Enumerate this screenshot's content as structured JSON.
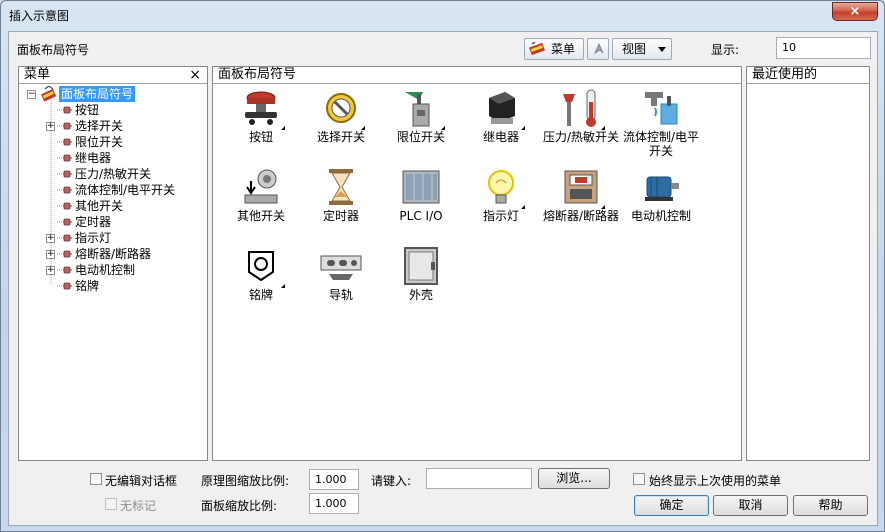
{
  "window": {
    "title": "插入示意图",
    "close_glyph": "×"
  },
  "header": {
    "section_label": "面板布局符号",
    "menu_button": "菜单",
    "view_button": "视图",
    "display_label": "显示:",
    "display_value": "10"
  },
  "menu_panel": {
    "title": "菜单",
    "close_glyph": "×",
    "root": "面板布局符号",
    "items": [
      {
        "label": "按钮",
        "expandable": false
      },
      {
        "label": "选择开关",
        "expandable": true
      },
      {
        "label": "限位开关",
        "expandable": false
      },
      {
        "label": "继电器",
        "expandable": false
      },
      {
        "label": "压力/热敏开关",
        "expandable": false
      },
      {
        "label": "流体控制/电平开关",
        "expandable": false
      },
      {
        "label": "其他开关",
        "expandable": false
      },
      {
        "label": "定时器",
        "expandable": false
      },
      {
        "label": "指示灯",
        "expandable": true
      },
      {
        "label": "熔断器/断路器",
        "expandable": true
      },
      {
        "label": "电动机控制",
        "expandable": true
      },
      {
        "label": "铭牌",
        "expandable": false
      }
    ]
  },
  "symbols_panel": {
    "title": "面板布局符号",
    "symbols": [
      {
        "label": "按钮",
        "icon": "push-button-icon"
      },
      {
        "label": "选择开关",
        "icon": "selector-switch-icon"
      },
      {
        "label": "限位开关",
        "icon": "limit-switch-icon"
      },
      {
        "label": "继电器",
        "icon": "relay-icon"
      },
      {
        "label": "压力/热敏开关",
        "icon": "pressure-temperature-switch-icon"
      },
      {
        "label": "流体控制/电平开关",
        "icon": "flow-level-switch-icon"
      },
      {
        "label": "其他开关",
        "icon": "other-switch-icon"
      },
      {
        "label": "定时器",
        "icon": "hourglass-timer-icon"
      },
      {
        "label": "PLC I/O",
        "icon": "plc-io-icon"
      },
      {
        "label": "指示灯",
        "icon": "light-bulb-icon"
      },
      {
        "label": "熔断器/断路器",
        "icon": "fuse-breaker-icon"
      },
      {
        "label": "电动机控制",
        "icon": "motor-control-icon"
      },
      {
        "label": "铭牌",
        "icon": "nameplate-icon"
      },
      {
        "label": "导轨",
        "icon": "din-rail-icon"
      },
      {
        "label": "外壳",
        "icon": "enclosure-icon"
      }
    ]
  },
  "recent_panel": {
    "title": "最近使用的"
  },
  "footer": {
    "no_edit_dialog": "无编辑对话框",
    "no_tag": "无标记",
    "schematic_scale_label": "原理图缩放比例:",
    "schematic_scale_value": "1.000",
    "panel_scale_label": "面板缩放比例:",
    "panel_scale_value": "1.000",
    "enter_label": "请键入:",
    "enter_value": "",
    "browse_button": "浏览...",
    "always_show_last_menu": "始终显示上次使用的菜单",
    "ok_button": "确定",
    "cancel_button": "取消",
    "help_button": "帮助"
  },
  "colors": {
    "selection": "#3399ff",
    "titlebar": "#c4d5e8",
    "close_button": "#c4402a"
  }
}
